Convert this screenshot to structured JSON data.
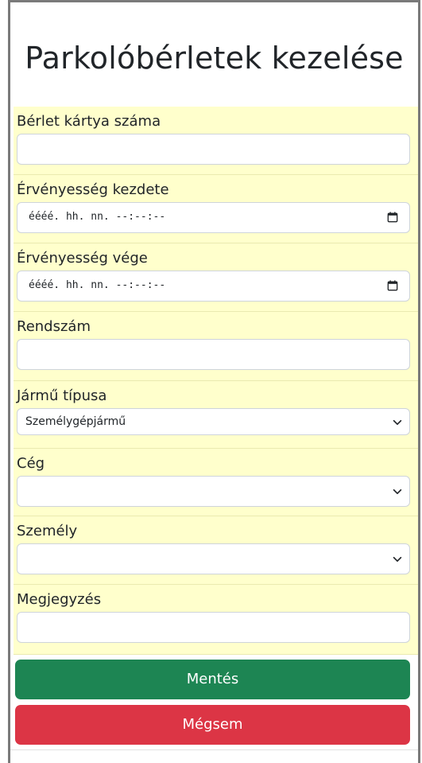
{
  "page": {
    "title": "Parkolóbérletek kezelése"
  },
  "form": {
    "card_number": {
      "label": "Bérlet kártya száma",
      "value": ""
    },
    "valid_from": {
      "label": "Érvényesség kezdete",
      "value": "éééé. hh. nn. --:--:--"
    },
    "valid_to": {
      "label": "Érvényesség vége",
      "value": "éééé. hh. nn. --:--:--"
    },
    "plate": {
      "label": "Rendszám",
      "value": ""
    },
    "vehicle_type": {
      "label": "Jármű típusa",
      "value": "Személygépjármű"
    },
    "company": {
      "label": "Cég",
      "value": ""
    },
    "person": {
      "label": "Személy",
      "value": ""
    },
    "note": {
      "label": "Megjegyzés",
      "value": ""
    }
  },
  "actions": {
    "save_label": "Mentés",
    "cancel_label": "Mégsem"
  },
  "colors": {
    "field_group_bg": "#ffffcc",
    "save": "#1d8553",
    "cancel": "#dc3545"
  },
  "icons": {
    "calendar": "calendar-icon",
    "chevron": "chevron-down-icon"
  }
}
